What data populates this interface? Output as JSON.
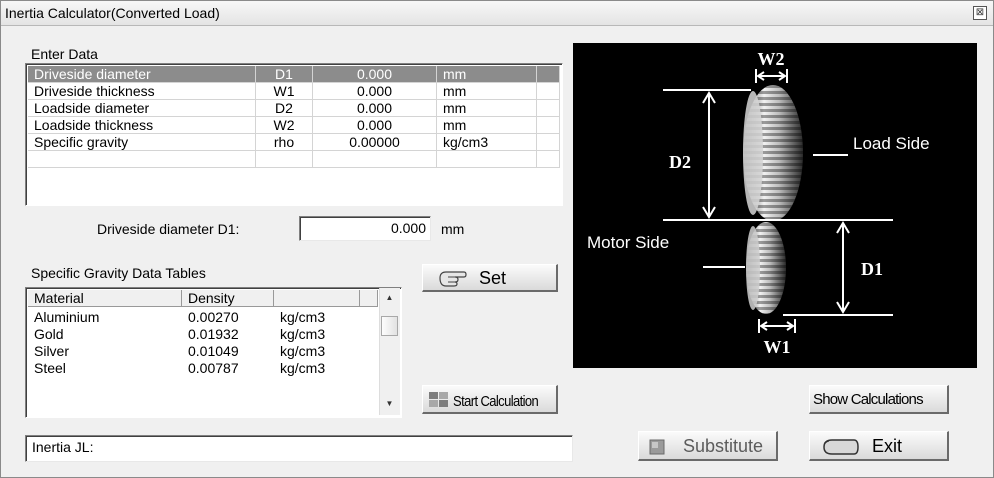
{
  "window": {
    "title": "Inertia Calculator(Converted Load)",
    "close_glyph": "⊠"
  },
  "enter_data": {
    "label": "Enter Data",
    "rows": [
      {
        "name": "Driveside diameter",
        "symbol": "D1",
        "value": "0.000",
        "unit": "mm",
        "selected": true
      },
      {
        "name": "Driveside thickness",
        "symbol": "W1",
        "value": "0.000",
        "unit": "mm"
      },
      {
        "name": "Loadside diameter",
        "symbol": "D2",
        "value": "0.000",
        "unit": "mm"
      },
      {
        "name": "Loadside thickness",
        "symbol": "W2",
        "value": "0.000",
        "unit": "mm"
      },
      {
        "name": "Specific gravity",
        "symbol": "rho",
        "value": "0.00000",
        "unit": "kg/cm3"
      }
    ]
  },
  "edit": {
    "label": "Driveside diameter  D1:",
    "value": "0.000",
    "unit": "mm"
  },
  "gravity_table": {
    "label": "Specific Gravity Data Tables",
    "headers": [
      "Material",
      "Density",
      ""
    ],
    "rows": [
      {
        "material": "Aluminium",
        "density": "0.00270",
        "unit": "kg/cm3"
      },
      {
        "material": "Gold",
        "density": "0.01932",
        "unit": "kg/cm3"
      },
      {
        "material": "Silver",
        "density": "0.01049",
        "unit": "kg/cm3"
      },
      {
        "material": "Steel",
        "density": "0.00787",
        "unit": "kg/cm3"
      }
    ]
  },
  "buttons": {
    "set": "Set",
    "start": "Start Calculation",
    "show": "Show Calculations",
    "substitute": "Substitute",
    "exit": "Exit"
  },
  "result": {
    "label": "Inertia JL:",
    "value": ""
  },
  "diagram": {
    "w2": "W2",
    "d2": "D2",
    "d1": "D1",
    "w1": "W1",
    "load_side": "Load Side",
    "motor_side": "Motor Side"
  }
}
